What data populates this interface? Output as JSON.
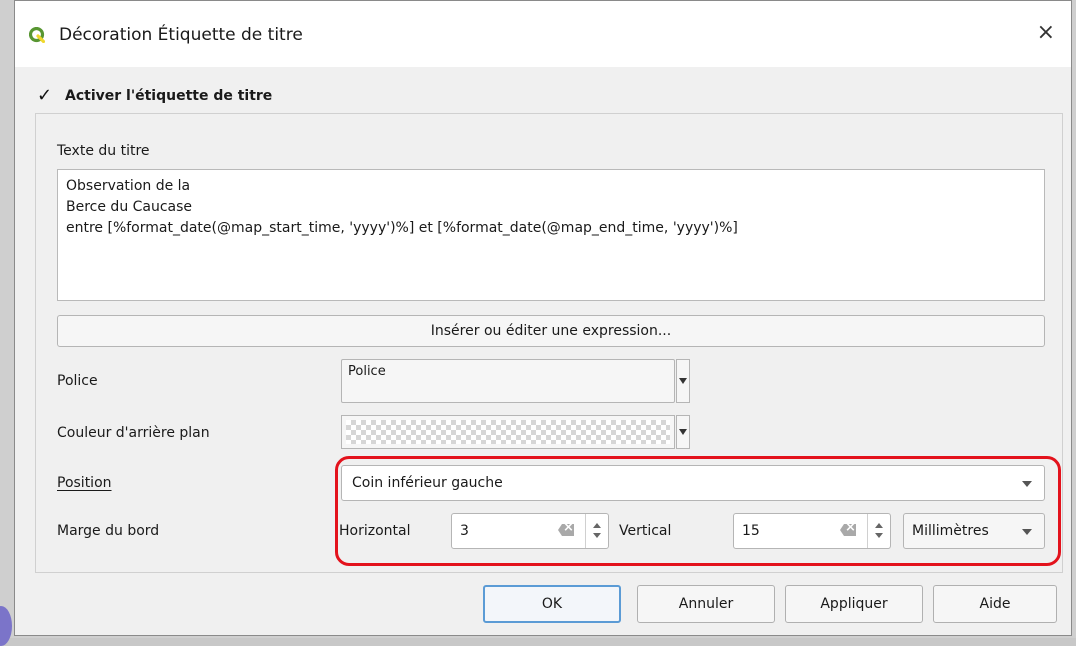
{
  "window": {
    "title": "Décoration Étiquette de titre",
    "close_glyph": "×"
  },
  "enable": {
    "checked": true,
    "check_glyph": "✓",
    "label": "Activer l'étiquette de titre"
  },
  "title_text": {
    "label": "Texte du titre",
    "value": "Observation de la\nBerce du Caucase\nentre [%format_date(@map_start_time, 'yyyy')%] et [%format_date(@map_end_time, 'yyyy')%]",
    "expression_button": "Insérer ou éditer une expression..."
  },
  "font": {
    "label": "Police",
    "button_text": "Police"
  },
  "background_color": {
    "label": "Couleur d'arrière plan"
  },
  "position": {
    "label": "Position",
    "value": "Coin inférieur gauche"
  },
  "margin": {
    "label": "Marge du bord",
    "horizontal_label": "Horizontal",
    "horizontal_value": "3",
    "vertical_label": "Vertical",
    "vertical_value": "15",
    "unit": "Millimètres"
  },
  "buttons": {
    "ok": "OK",
    "cancel": "Annuler",
    "apply": "Appliquer",
    "help": "Aide"
  },
  "colors": {
    "highlight": "#e3121c",
    "qgis_green": "#589632",
    "qgis_yellow": "#f0d82e"
  }
}
